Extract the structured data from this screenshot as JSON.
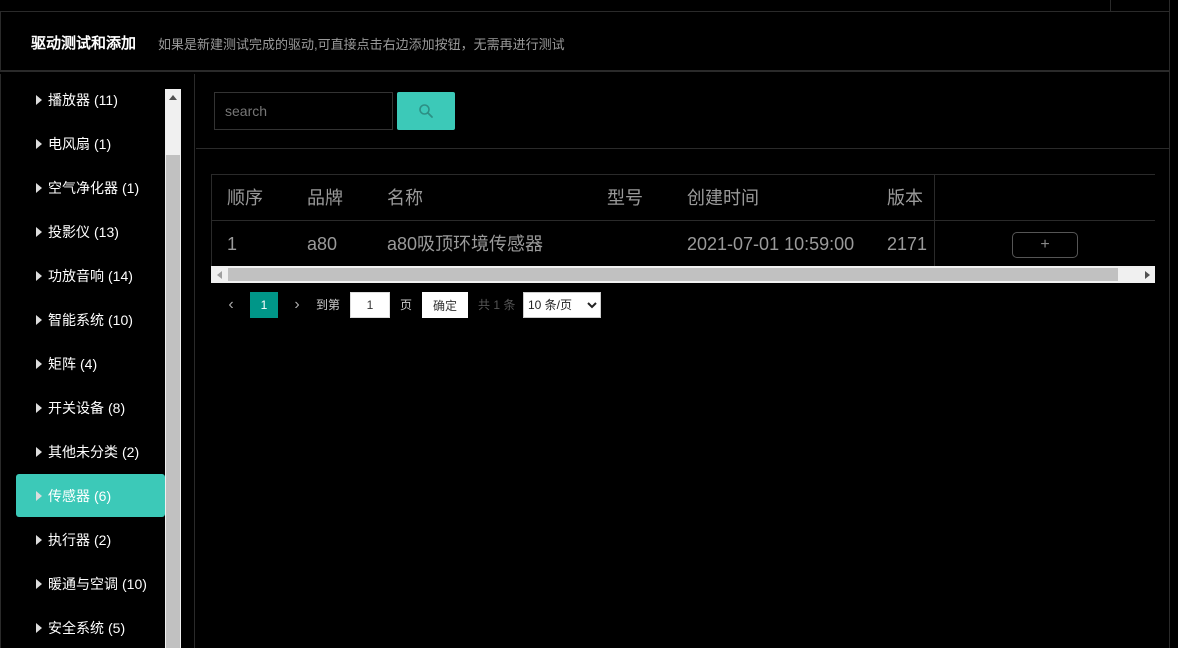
{
  "header": {
    "title": "驱动测试和添加",
    "hint": "如果是新建测试完成的驱动,可直接点击右边添加按钮，无需再进行测试"
  },
  "sidebar": {
    "items": [
      {
        "label": "播放器",
        "count": "(11)",
        "active": false
      },
      {
        "label": "电风扇",
        "count": "(1)",
        "active": false
      },
      {
        "label": "空气净化器",
        "count": "(1)",
        "active": false
      },
      {
        "label": "投影仪",
        "count": "(13)",
        "active": false
      },
      {
        "label": "功放音响",
        "count": "(14)",
        "active": false
      },
      {
        "label": "智能系统",
        "count": "(10)",
        "active": false
      },
      {
        "label": "矩阵",
        "count": "(4)",
        "active": false
      },
      {
        "label": "开关设备",
        "count": "(8)",
        "active": false
      },
      {
        "label": "其他未分类",
        "count": "(2)",
        "active": false
      },
      {
        "label": "传感器",
        "count": "(6)",
        "active": true
      },
      {
        "label": "执行器",
        "count": "(2)",
        "active": false
      },
      {
        "label": "暖通与空调",
        "count": "(10)",
        "active": false
      },
      {
        "label": "安全系统",
        "count": "(5)",
        "active": false
      }
    ]
  },
  "search": {
    "placeholder": "search",
    "value": ""
  },
  "table": {
    "columns": [
      "顺序",
      "品牌",
      "名称",
      "型号",
      "创建时间",
      "版本"
    ],
    "rows": [
      {
        "order": "1",
        "brand": "a80",
        "name": "a80吸顶环境传感器",
        "model": "",
        "created": "2021-07-01 10:59:00",
        "version": "2171",
        "action": "+"
      }
    ]
  },
  "pager": {
    "current": "1",
    "goto_label": "到第",
    "goto_value": "1",
    "page_label": "页",
    "confirm_label": "确定",
    "total": "共 1 条",
    "page_size": "10 条/页",
    "page_size_options": [
      "10 条/页"
    ]
  },
  "colors": {
    "accent": "#3cc9b8",
    "page_active": "#009688",
    "background": "#000000"
  }
}
